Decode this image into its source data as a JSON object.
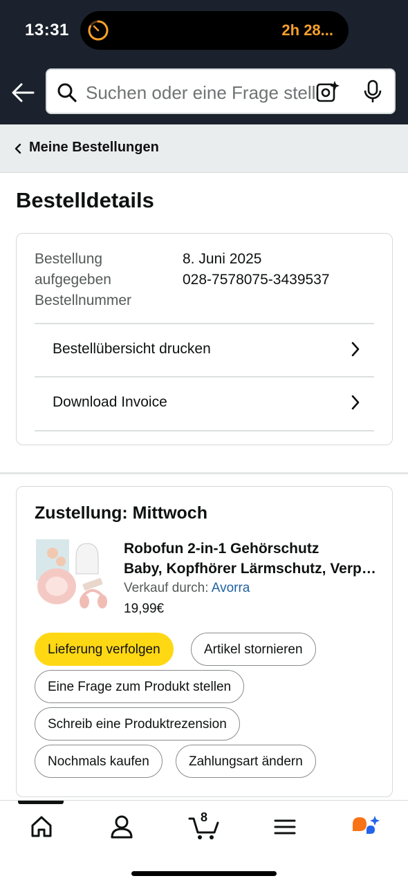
{
  "status_bar": {
    "time": "13:31",
    "activity_text": "2h 28..."
  },
  "search": {
    "placeholder": "Suchen oder eine Frage stellen"
  },
  "breadcrumb": {
    "label": "Meine Bestellungen"
  },
  "page_title": "Bestelldetails",
  "order_info": {
    "date_label_line1": "Bestellung",
    "date_label_line2": "aufgegeben",
    "number_label": "Bestellnummer",
    "date_value": "8. Juni 2025",
    "number_value": "028-7578075-3439537",
    "actions": [
      {
        "label": "Bestellübersicht drucken"
      },
      {
        "label": "Download Invoice"
      }
    ]
  },
  "delivery": {
    "title": "Zustellung: Mittwoch",
    "product": {
      "title_line1": "Robofun 2-in-1 Gehörschutz",
      "title_line2": "Baby, Kopfhörer Lärmschutz, Verpackung...",
      "seller_prefix": "Verkauf durch: ",
      "seller_name": "Avorra",
      "price": "19,99€"
    },
    "buttons": [
      {
        "label": "Lieferung verfolgen",
        "primary": true
      },
      {
        "label": "Artikel stornieren"
      },
      {
        "label": "Eine Frage zum Produkt stellen"
      },
      {
        "label": "Schreib eine Produktrezension"
      },
      {
        "label": "Nochmals kaufen"
      },
      {
        "label": "Zahlungsart ändern"
      }
    ]
  },
  "bottom_nav": {
    "items": [
      "home-icon",
      "account-icon",
      "cart-icon",
      "menu-icon",
      "rufus-icon"
    ],
    "cart_count": "8"
  },
  "colors": {
    "header_bg": "#1b222d",
    "primary_button": "#ffd814",
    "link": "#2162a1",
    "activity_accent": "#f7a12a"
  }
}
